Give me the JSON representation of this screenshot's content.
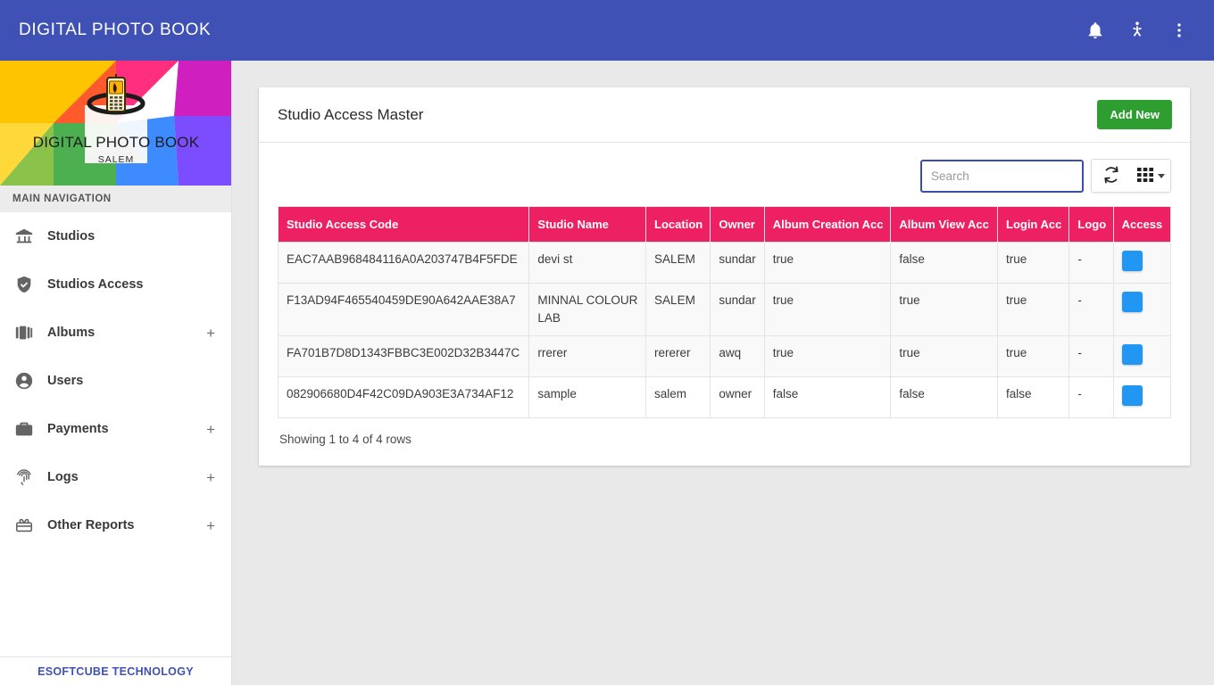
{
  "topbar": {
    "app_title": "DIGITAL PHOTO BOOK",
    "background": "#3f51b5",
    "actions": [
      {
        "name": "notifications-icon",
        "label": "Notifications"
      },
      {
        "name": "accessibility-icon",
        "label": "Accessibility"
      },
      {
        "name": "more-vertical-icon",
        "label": "More options"
      }
    ]
  },
  "sidebar": {
    "brand_name": "DIGITAL PHOTO BOOK",
    "brand_sub": "SALEM",
    "section_title": "MAIN NAVIGATION",
    "items": [
      {
        "label": "Studios",
        "icon": "bank-icon",
        "expandable": false,
        "expand_glyph": ""
      },
      {
        "label": "Studios Access",
        "icon": "shield-check-icon",
        "expandable": false,
        "expand_glyph": ""
      },
      {
        "label": "Albums",
        "icon": "albums-icon",
        "expandable": true,
        "expand_glyph": "+"
      },
      {
        "label": "Users",
        "icon": "account-circle-icon",
        "expandable": false,
        "expand_glyph": ""
      },
      {
        "label": "Payments",
        "icon": "briefcase-icon",
        "expandable": true,
        "expand_glyph": "+"
      },
      {
        "label": "Logs",
        "icon": "fingerprint-icon",
        "expandable": true,
        "expand_glyph": "+"
      },
      {
        "label": "Other Reports",
        "icon": "gift-card-icon",
        "expandable": true,
        "expand_glyph": "+"
      }
    ],
    "footer_text": "ESOFTCUBE TECHNOLOGY",
    "footer_color": "#3f51b5"
  },
  "card": {
    "title": "Studio Access Master",
    "add_new_label": "Add New",
    "add_new_color": "#2e9e31"
  },
  "toolbar": {
    "search_placeholder": "Search",
    "search_value": "",
    "refresh_label": "Refresh",
    "columns_label": "Columns"
  },
  "table": {
    "header_color": "#ee2064",
    "columns": [
      "Studio Access Code",
      "Studio Name",
      "Location",
      "Owner",
      "Album Creation Acc",
      "Album View Acc",
      "Login Acc",
      "Logo",
      "Access"
    ],
    "rows": [
      {
        "studio_access_code": "EAC7AAB968484116A0A203747B4F5FDE",
        "studio_name": "devi st",
        "location": "SALEM",
        "owner": "sundar",
        "album_creation_acc": "true",
        "album_view_acc": "false",
        "login_acc": "true",
        "logo": "-",
        "access": "access-button"
      },
      {
        "studio_access_code": "F13AD94F465540459DE90A642AAE38A7",
        "studio_name": "MINNAL COLOUR LAB",
        "location": "SALEM",
        "owner": "sundar",
        "album_creation_acc": "true",
        "album_view_acc": "true",
        "login_acc": "true",
        "logo": "-",
        "access": "access-button"
      },
      {
        "studio_access_code": "FA701B7D8D1343FBBC3E002D32B3447C",
        "studio_name": "rrerer",
        "location": "rererer",
        "owner": "awq",
        "album_creation_acc": "true",
        "album_view_acc": "true",
        "login_acc": "true",
        "logo": "-",
        "access": "access-button"
      },
      {
        "studio_access_code": "082906680D4F42C09DA903E3A734AF12",
        "studio_name": "sample",
        "location": "salem",
        "owner": "owner",
        "album_creation_acc": "false",
        "album_view_acc": "false",
        "login_acc": "false",
        "logo": "-",
        "access": "access-button"
      }
    ],
    "status": "Showing 1 to 4 of 4 rows",
    "access_button_color": "#2196f3"
  }
}
